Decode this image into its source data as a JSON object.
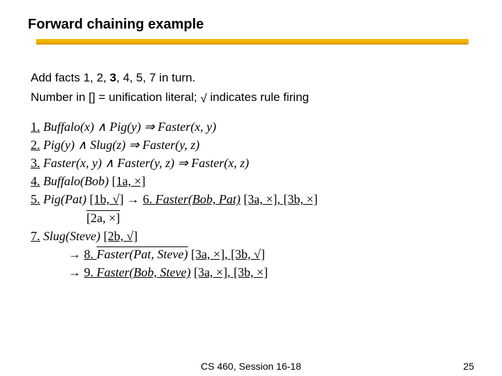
{
  "title": "Forward chaining example",
  "intro": {
    "line1_a": "Add facts 1, 2, ",
    "line1_bold": "3",
    "line1_b": ", 4, 5, 7 in turn.",
    "line2_a": "Number in [] = unification literal;  ",
    "line2_b": " indicates rule firing"
  },
  "rules": {
    "r1_no": "1.",
    "r1_body": "Buffalo(x) ∧ Pig(y)  ⇒  Faster(x, y)",
    "r2_no": "2.",
    "r2_body": "Pig(y) ∧ Slug(z)  ⇒  Faster(y, z)",
    "r3_no": "3.",
    "r3_body": "Faster(x, y) ∧ Faster(y, z)  ⇒  Faster(x, z)",
    "r4_no": "4.",
    "r4_body": "Buffalo(Bob) ",
    "r4_tag": "[1a, ×]",
    "r5_no": "5.",
    "r5_body": "Pig(Pat) ",
    "r5_tag1": "[1b, √]",
    "r5_arrow": " → ",
    "r5_sixno": "6. ",
    "r5_six": "Faster(Bob, Pat)",
    "r5_tag2": " [3a, ×]",
    "r5_tag3": ", [3b, ×]",
    "r5_line2_tag": "[2a, ×]",
    "r7_no": "7.",
    "r7_body": "Slug(Steve) ",
    "r7_tag": "[2b, √]",
    "r8_arrow": "→",
    "r8_no": "8. ",
    "r8_body": "Faster(Pat, Steve)",
    "r8_tag1": " [3a, ×]",
    "r8_tag2": ",  [3b, √]",
    "r9_arrow": "→",
    "r9_no": "9. ",
    "r9_body": "Faster(Bob, Steve)",
    "r9_tag1": " [3a, ×]",
    "r9_tag2": ",  [3b, ×]"
  },
  "footer": {
    "course": "CS 460,  Session 16-18",
    "page": "25"
  },
  "icons": {
    "radic": "√"
  }
}
